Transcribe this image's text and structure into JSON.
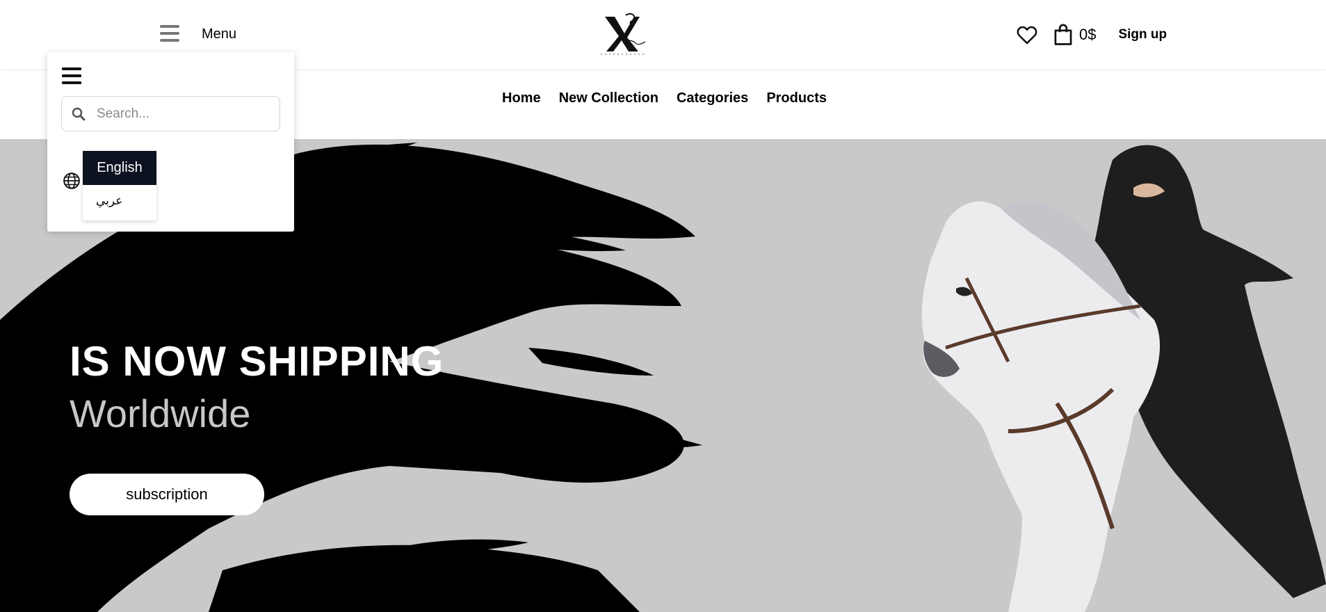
{
  "header": {
    "menu_label": "Menu",
    "cart_total": "0$",
    "signup_label": "Sign up"
  },
  "nav": {
    "items": [
      "Home",
      "New Collection",
      "Categories",
      "Products"
    ]
  },
  "menu_panel": {
    "search_placeholder": "Search...",
    "languages": [
      "English",
      "عربي"
    ],
    "selected_language": "English"
  },
  "hero": {
    "title": "IS NOW SHIPPING",
    "subtitle": "Worldwide",
    "button_label": "subscription"
  },
  "colors": {
    "hero_background": "#c9c9c9",
    "selected_language_bg": "#0d1220",
    "brush": "#000000"
  },
  "icons": [
    "hamburger-icon",
    "heart-icon",
    "shopping-bag-icon",
    "search-icon",
    "globe-icon"
  ]
}
